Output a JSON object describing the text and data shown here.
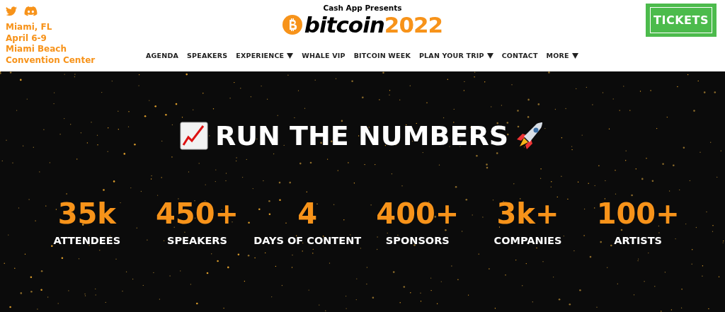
{
  "header": {
    "event_info": [
      "Miami, FL",
      "April 6-9",
      "Miami Beach",
      "Convention Center"
    ],
    "presenter": "Cash App Presents",
    "logo": {
      "word": "bitcoin",
      "year": "2022"
    },
    "nav": [
      {
        "label": "AGENDA",
        "has_menu": false
      },
      {
        "label": "SPEAKERS",
        "has_menu": false
      },
      {
        "label": "EXPERIENCE",
        "has_menu": true
      },
      {
        "label": "WHALE VIP",
        "has_menu": false
      },
      {
        "label": "BITCOIN WEEK",
        "has_menu": false
      },
      {
        "label": "PLAN YOUR TRIP",
        "has_menu": true
      },
      {
        "label": "CONTACT",
        "has_menu": false
      },
      {
        "label": "MORE",
        "has_menu": true
      }
    ],
    "tickets_button": "TICKETS"
  },
  "hero": {
    "title": "RUN THE NUMBERS",
    "stats": [
      {
        "value": "35k",
        "label": "ATTENDEES"
      },
      {
        "value": "450+",
        "label": "SPEAKERS"
      },
      {
        "value": "4",
        "label": "DAYS OF CONTENT"
      },
      {
        "value": "400+",
        "label": "SPONSORS"
      },
      {
        "value": "3k+",
        "label": "COMPANIES"
      },
      {
        "value": "100+",
        "label": "ARTISTS"
      }
    ]
  }
}
